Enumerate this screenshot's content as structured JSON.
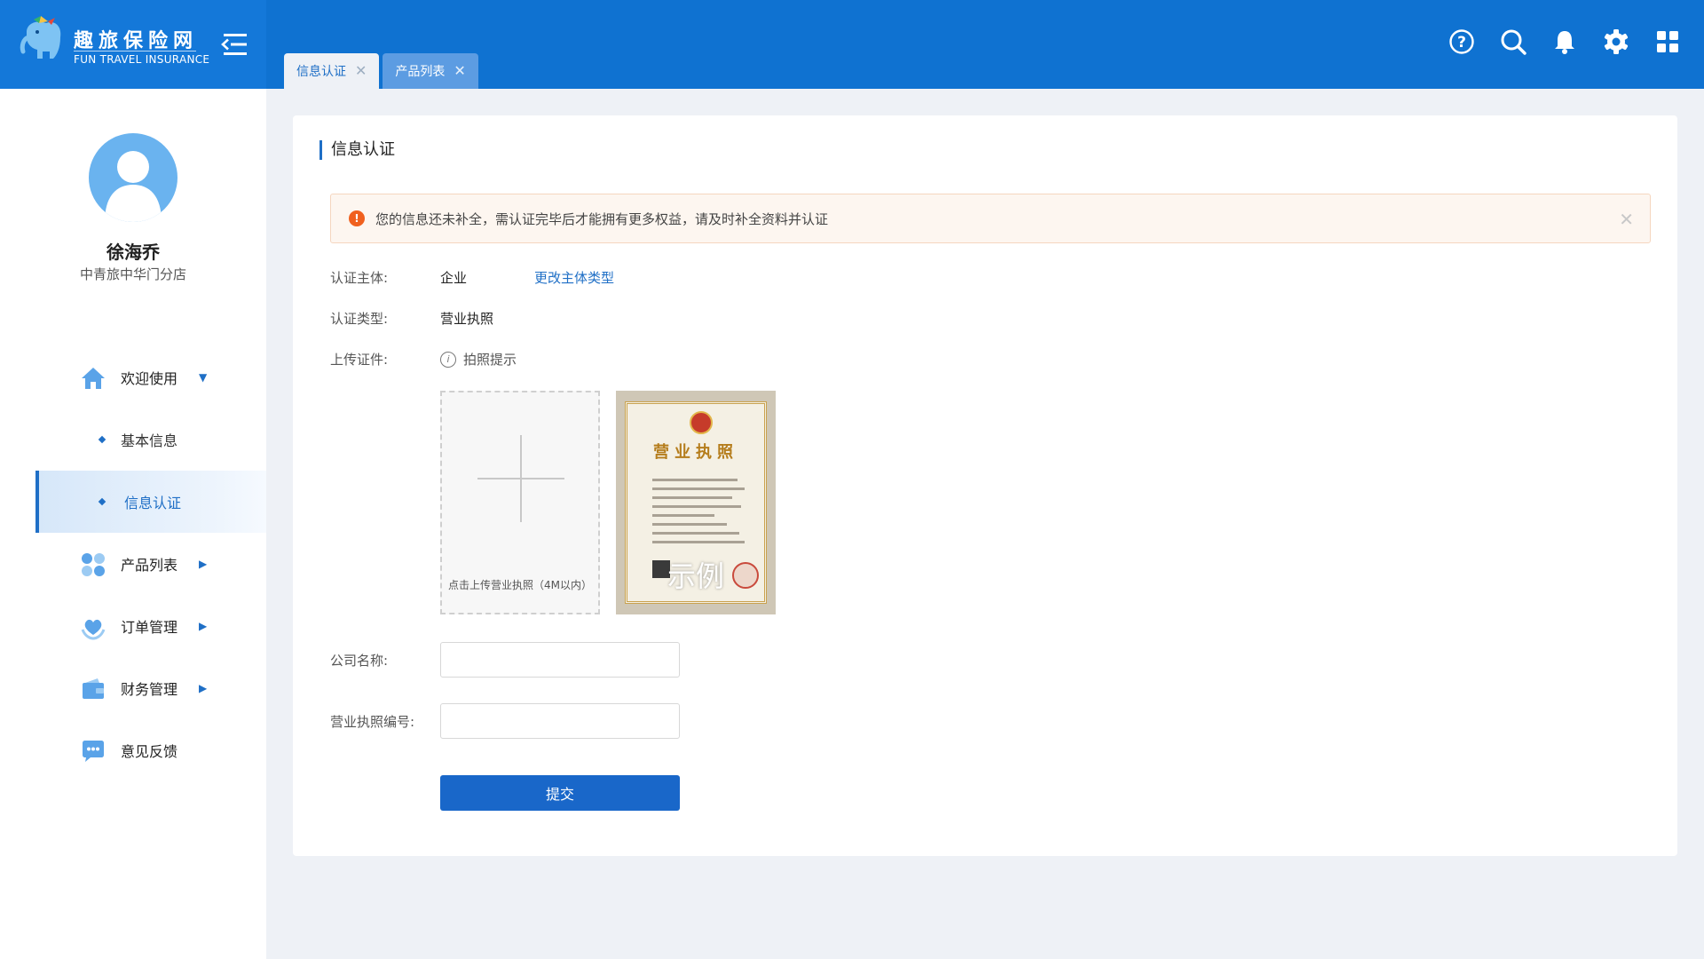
{
  "brand": {
    "title": "趣旅保险网",
    "subtitle": "FUN TRAVEL INSURANCE",
    "primary_color": "#0f72d1",
    "accent_color": "#1f6fc6"
  },
  "tabs": [
    {
      "label": "信息认证",
      "active": true
    },
    {
      "label": "产品列表",
      "active": false
    }
  ],
  "header_icons": [
    "help-icon",
    "search-icon",
    "bell-icon",
    "settings-icon",
    "apps-grid-icon"
  ],
  "user": {
    "name": "徐海乔",
    "org": "中青旅中华门分店"
  },
  "sidebar": {
    "items": [
      {
        "label": "欢迎使用",
        "icon": "home-icon",
        "caret": "▼"
      },
      {
        "label": "基本信息",
        "sub": true
      },
      {
        "label": "信息认证",
        "sub": true,
        "active": true
      },
      {
        "label": "产品列表",
        "icon": "products-icon",
        "caret": "▶"
      },
      {
        "label": "订单管理",
        "icon": "orders-icon",
        "caret": "▶"
      },
      {
        "label": "财务管理",
        "icon": "wallet-icon",
        "caret": "▶"
      },
      {
        "label": "意见反馈",
        "icon": "feedback-icon"
      }
    ]
  },
  "page": {
    "title": "信息认证",
    "alert": "您的信息还未补全，需认证完毕后才能拥有更多权益，请及时补全资料并认证",
    "subject_label": "认证主体:",
    "subject_value": "企业",
    "change_subject_link": "更改主体类型",
    "type_label": "认证类型:",
    "type_value": "营业执照",
    "upload_label": "上传证件:",
    "photo_tip": "拍照提示",
    "upload_hint": "点击上传营业执照（4M以内）",
    "sample_doc_title": "营业执照",
    "sample_label": "示例",
    "company_label": "公司名称:",
    "company_value": "",
    "license_label": "营业执照编号:",
    "license_value": "",
    "submit_label": "提交"
  }
}
